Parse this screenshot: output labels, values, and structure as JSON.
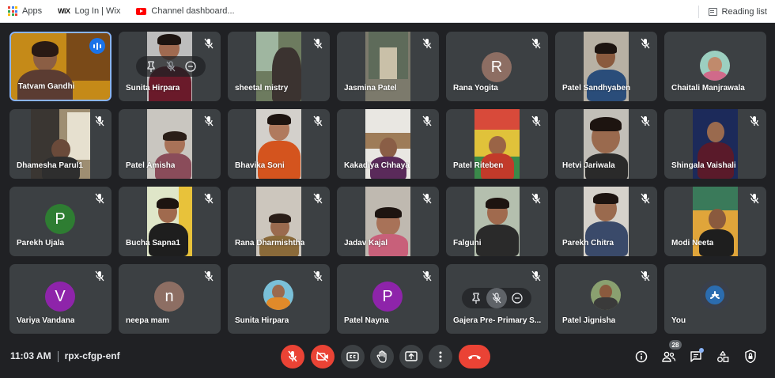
{
  "bookmarks": [
    {
      "label": "Apps",
      "icon": "apps-grid-icon"
    },
    {
      "label": "Log In | Wix",
      "icon": "wix-icon"
    },
    {
      "label": "Channel dashboard...",
      "icon": "youtube-icon"
    }
  ],
  "reading_list_label": "Reading list",
  "wix_glyph": "WiX",
  "participants": [
    "Tatvam Gandhi",
    "Sunita Hirpara",
    "sheetal mistry",
    "Jasmina Patel",
    "Rana Yogita",
    "Patel Sandhyaben",
    "Chaitali Manjrawala",
    "Dhamesha Parul1",
    "Patel Amisha",
    "Bhavika Soni",
    "Kakadiya Chhaya",
    "Patel Riteben",
    "Hetvi Jariwala",
    "Shingala Vaishali",
    "Parekh Ujala",
    "Bucha Sapna1",
    "Rana Dharmishtha",
    "Jadav Kajal",
    "Falguni",
    "Parekh Chitra",
    "Modi Neeta",
    "Variya Vandana",
    "neepa mam",
    "Sunita Hirpara",
    "Patel Nayna",
    "Gajera Pre- Primary S...",
    "Patel Jignisha",
    "You"
  ],
  "avatars": {
    "rana_yogita": "R",
    "parekh_ujala": "P",
    "variya_vandana": "V",
    "neepa_mam": "n",
    "patel_nayna": "P"
  },
  "colors": {
    "avatar_brown": "#8d6e63",
    "avatar_green": "#2e7d32",
    "avatar_purple": "#8e24aa",
    "speaking_blue": "#1a73e8",
    "end_call_red": "#ea4335"
  },
  "meeting": {
    "time": "11:03 AM",
    "code": "rpx-cfgp-enf",
    "participant_count": "28"
  }
}
